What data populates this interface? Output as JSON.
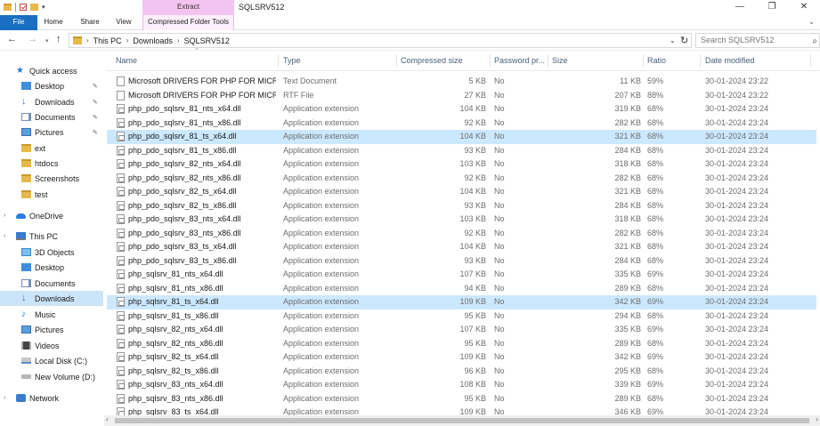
{
  "window": {
    "extract_tab": "Extract",
    "title": "SQLSRV512",
    "minimize": "—",
    "maximize": "❐",
    "close": "✕"
  },
  "ribbon": {
    "tabs": [
      "File",
      "Home",
      "Share",
      "View",
      "Compressed Folder Tools"
    ],
    "collapse_icon": "chevron-down"
  },
  "address": {
    "crumbs": [
      "This PC",
      "Downloads",
      "SQLSRV512"
    ],
    "search_placeholder": "Search SQLSRV512"
  },
  "sidebar": {
    "items": [
      {
        "label": "Quick access",
        "icon": "star-icon",
        "pinned": false
      },
      {
        "label": "Desktop",
        "icon": "desktop-icon",
        "pinned": true
      },
      {
        "label": "Downloads",
        "icon": "download-icon",
        "pinned": true
      },
      {
        "label": "Documents",
        "icon": "documents-icon",
        "pinned": true
      },
      {
        "label": "Pictures",
        "icon": "pictures-icon",
        "pinned": true
      },
      {
        "label": "ext",
        "icon": "folder-icon",
        "pinned": false
      },
      {
        "label": "htdocs",
        "icon": "folder-icon",
        "pinned": false
      },
      {
        "label": "Screenshots",
        "icon": "folder-icon",
        "pinned": false
      },
      {
        "label": "test",
        "icon": "folder-icon",
        "pinned": false
      },
      {
        "label": "OneDrive",
        "icon": "cloud-icon",
        "pinned": false
      },
      {
        "label": "This PC",
        "icon": "computer-icon",
        "pinned": false
      },
      {
        "label": "3D Objects",
        "icon": "3d-objects-icon",
        "pinned": false
      },
      {
        "label": "Desktop",
        "icon": "desktop-icon",
        "pinned": false
      },
      {
        "label": "Documents",
        "icon": "documents-icon",
        "pinned": false
      },
      {
        "label": "Downloads",
        "icon": "download-icon",
        "pinned": false
      },
      {
        "label": "Music",
        "icon": "music-icon",
        "pinned": false
      },
      {
        "label": "Pictures",
        "icon": "pictures-icon",
        "pinned": false
      },
      {
        "label": "Videos",
        "icon": "videos-icon",
        "pinned": false
      },
      {
        "label": "Local Disk (C:)",
        "icon": "disk-icon",
        "pinned": false
      },
      {
        "label": "New Volume (D:)",
        "icon": "drive-icon",
        "pinned": false
      },
      {
        "label": "Network",
        "icon": "network-icon",
        "pinned": false
      }
    ],
    "selected": "Downloads"
  },
  "columns": [
    "Name",
    "Type",
    "Compressed size",
    "Password pr...",
    "Size",
    "Ratio",
    "Date modified"
  ],
  "files": [
    {
      "name": "Microsoft DRIVERS FOR PHP FOR MICR...",
      "type": "Text Document",
      "csize": "5 KB",
      "pwd": "No",
      "size": "11 KB",
      "ratio": "59%",
      "date": "30-01-2024 23:22",
      "kind": "txt"
    },
    {
      "name": "Microsoft DRIVERS FOR PHP FOR MICR...",
      "type": "RTF File",
      "csize": "27 KB",
      "pwd": "No",
      "size": "207 KB",
      "ratio": "88%",
      "date": "30-01-2024 23:22",
      "kind": "txt"
    },
    {
      "name": "php_pdo_sqlsrv_81_nts_x64.dll",
      "type": "Application extension",
      "csize": "104 KB",
      "pwd": "No",
      "size": "319 KB",
      "ratio": "68%",
      "date": "30-01-2024 23:24",
      "kind": "dll"
    },
    {
      "name": "php_pdo_sqlsrv_81_nts_x86.dll",
      "type": "Application extension",
      "csize": "92 KB",
      "pwd": "No",
      "size": "282 KB",
      "ratio": "68%",
      "date": "30-01-2024 23:24",
      "kind": "dll"
    },
    {
      "name": "php_pdo_sqlsrv_81_ts_x64.dll",
      "type": "Application extension",
      "csize": "104 KB",
      "pwd": "No",
      "size": "321 KB",
      "ratio": "68%",
      "date": "30-01-2024 23:24",
      "kind": "dll",
      "selected": true
    },
    {
      "name": "php_pdo_sqlsrv_81_ts_x86.dll",
      "type": "Application extension",
      "csize": "93 KB",
      "pwd": "No",
      "size": "284 KB",
      "ratio": "68%",
      "date": "30-01-2024 23:24",
      "kind": "dll"
    },
    {
      "name": "php_pdo_sqlsrv_82_nts_x64.dll",
      "type": "Application extension",
      "csize": "103 KB",
      "pwd": "No",
      "size": "318 KB",
      "ratio": "68%",
      "date": "30-01-2024 23:24",
      "kind": "dll"
    },
    {
      "name": "php_pdo_sqlsrv_82_nts_x86.dll",
      "type": "Application extension",
      "csize": "92 KB",
      "pwd": "No",
      "size": "282 KB",
      "ratio": "68%",
      "date": "30-01-2024 23:24",
      "kind": "dll"
    },
    {
      "name": "php_pdo_sqlsrv_82_ts_x64.dll",
      "type": "Application extension",
      "csize": "104 KB",
      "pwd": "No",
      "size": "321 KB",
      "ratio": "68%",
      "date": "30-01-2024 23:24",
      "kind": "dll"
    },
    {
      "name": "php_pdo_sqlsrv_82_ts_x86.dll",
      "type": "Application extension",
      "csize": "93 KB",
      "pwd": "No",
      "size": "284 KB",
      "ratio": "68%",
      "date": "30-01-2024 23:24",
      "kind": "dll"
    },
    {
      "name": "php_pdo_sqlsrv_83_nts_x64.dll",
      "type": "Application extension",
      "csize": "103 KB",
      "pwd": "No",
      "size": "318 KB",
      "ratio": "68%",
      "date": "30-01-2024 23:24",
      "kind": "dll"
    },
    {
      "name": "php_pdo_sqlsrv_83_nts_x86.dll",
      "type": "Application extension",
      "csize": "92 KB",
      "pwd": "No",
      "size": "282 KB",
      "ratio": "68%",
      "date": "30-01-2024 23:24",
      "kind": "dll"
    },
    {
      "name": "php_pdo_sqlsrv_83_ts_x64.dll",
      "type": "Application extension",
      "csize": "104 KB",
      "pwd": "No",
      "size": "321 KB",
      "ratio": "68%",
      "date": "30-01-2024 23:24",
      "kind": "dll"
    },
    {
      "name": "php_pdo_sqlsrv_83_ts_x86.dll",
      "type": "Application extension",
      "csize": "93 KB",
      "pwd": "No",
      "size": "284 KB",
      "ratio": "68%",
      "date": "30-01-2024 23:24",
      "kind": "dll"
    },
    {
      "name": "php_sqlsrv_81_nts_x64.dll",
      "type": "Application extension",
      "csize": "107 KB",
      "pwd": "No",
      "size": "335 KB",
      "ratio": "69%",
      "date": "30-01-2024 23:24",
      "kind": "dll"
    },
    {
      "name": "php_sqlsrv_81_nts_x86.dll",
      "type": "Application extension",
      "csize": "94 KB",
      "pwd": "No",
      "size": "289 KB",
      "ratio": "68%",
      "date": "30-01-2024 23:24",
      "kind": "dll"
    },
    {
      "name": "php_sqlsrv_81_ts_x64.dll",
      "type": "Application extension",
      "csize": "109 KB",
      "pwd": "No",
      "size": "342 KB",
      "ratio": "69%",
      "date": "30-01-2024 23:24",
      "kind": "dll",
      "selected": true
    },
    {
      "name": "php_sqlsrv_81_ts_x86.dll",
      "type": "Application extension",
      "csize": "95 KB",
      "pwd": "No",
      "size": "294 KB",
      "ratio": "68%",
      "date": "30-01-2024 23:24",
      "kind": "dll"
    },
    {
      "name": "php_sqlsrv_82_nts_x64.dll",
      "type": "Application extension",
      "csize": "107 KB",
      "pwd": "No",
      "size": "335 KB",
      "ratio": "69%",
      "date": "30-01-2024 23:24",
      "kind": "dll"
    },
    {
      "name": "php_sqlsrv_82_nts_x86.dll",
      "type": "Application extension",
      "csize": "95 KB",
      "pwd": "No",
      "size": "289 KB",
      "ratio": "68%",
      "date": "30-01-2024 23:24",
      "kind": "dll"
    },
    {
      "name": "php_sqlsrv_82_ts_x64.dll",
      "type": "Application extension",
      "csize": "109 KB",
      "pwd": "No",
      "size": "342 KB",
      "ratio": "69%",
      "date": "30-01-2024 23:24",
      "kind": "dll"
    },
    {
      "name": "php_sqlsrv_82_ts_x86.dll",
      "type": "Application extension",
      "csize": "96 KB",
      "pwd": "No",
      "size": "295 KB",
      "ratio": "68%",
      "date": "30-01-2024 23:24",
      "kind": "dll"
    },
    {
      "name": "php_sqlsrv_83_nts_x64.dll",
      "type": "Application extension",
      "csize": "108 KB",
      "pwd": "No",
      "size": "339 KB",
      "ratio": "69%",
      "date": "30-01-2024 23:24",
      "kind": "dll"
    },
    {
      "name": "php_sqlsrv_83_nts_x86.dll",
      "type": "Application extension",
      "csize": "95 KB",
      "pwd": "No",
      "size": "289 KB",
      "ratio": "68%",
      "date": "30-01-2024 23:24",
      "kind": "dll",
      "hover": true
    },
    {
      "name": "php_sqlsrv_83_ts_x64.dll",
      "type": "Application extension",
      "csize": "109 KB",
      "pwd": "No",
      "size": "346 KB",
      "ratio": "69%",
      "date": "30-01-2024 23:24",
      "kind": "dll"
    }
  ],
  "colors": {
    "file_tab": "#1a6fc2",
    "context_tab": "#f4c4f0",
    "selection": "#cce8ff",
    "nav_selection": "#cce4f7",
    "header_text": "#4c607a"
  }
}
